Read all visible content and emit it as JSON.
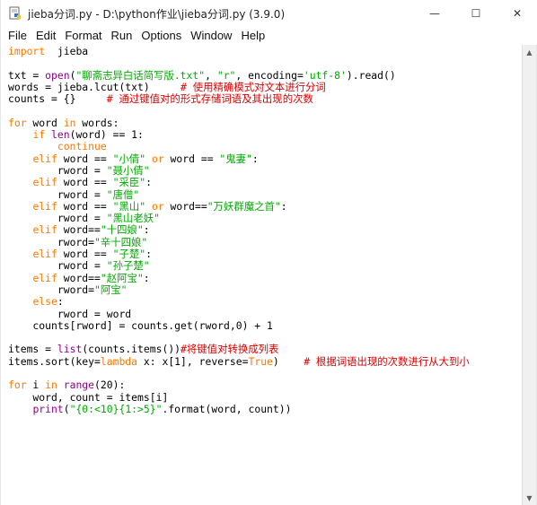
{
  "window": {
    "title": "jieba分词.py - D:\\python作业\\jieba分词.py (3.9.0)",
    "controls": {
      "minimize": "—",
      "maximize": "☐",
      "close": "✕"
    }
  },
  "menu": [
    "File",
    "Edit",
    "Format",
    "Run",
    "Options",
    "Window",
    "Help"
  ],
  "icons": {
    "app": "python-idle-file-icon"
  },
  "colors": {
    "keyword": "#ff7700",
    "builtin": "#900090",
    "string": "#00aa00",
    "comment": "#dd0000",
    "text": "#000000"
  },
  "code_lines": [
    [
      {
        "t": "kw",
        "s": "import"
      },
      {
        "t": "n",
        "s": "  jieba"
      }
    ],
    [],
    [
      {
        "t": "n",
        "s": "txt = "
      },
      {
        "t": "bi",
        "s": "open"
      },
      {
        "t": "n",
        "s": "("
      },
      {
        "t": "str",
        "s": "\"聊斋志异白话简写版.txt\""
      },
      {
        "t": "n",
        "s": ", "
      },
      {
        "t": "str",
        "s": "\"r\""
      },
      {
        "t": "n",
        "s": ", encoding="
      },
      {
        "t": "str",
        "s": "'utf-8'"
      },
      {
        "t": "n",
        "s": ").read()"
      }
    ],
    [
      {
        "t": "n",
        "s": "words = jieba.lcut(txt)     "
      },
      {
        "t": "cmt",
        "s": "# 使用精确模式对文本进行分词"
      }
    ],
    [
      {
        "t": "n",
        "s": "counts = {}     "
      },
      {
        "t": "cmt",
        "s": "# 通过键值对的形式存储词语及其出现的次数"
      }
    ],
    [],
    [
      {
        "t": "kw",
        "s": "for"
      },
      {
        "t": "n",
        "s": " word "
      },
      {
        "t": "kw",
        "s": "in"
      },
      {
        "t": "n",
        "s": " words:"
      }
    ],
    [
      {
        "t": "n",
        "s": "    "
      },
      {
        "t": "kw",
        "s": "if"
      },
      {
        "t": "n",
        "s": " "
      },
      {
        "t": "bi",
        "s": "len"
      },
      {
        "t": "n",
        "s": "(word) == 1:"
      }
    ],
    [
      {
        "t": "n",
        "s": "        "
      },
      {
        "t": "kw",
        "s": "continue"
      }
    ],
    [
      {
        "t": "n",
        "s": "    "
      },
      {
        "t": "kw",
        "s": "elif"
      },
      {
        "t": "n",
        "s": " word == "
      },
      {
        "t": "str",
        "s": "\"小倩\""
      },
      {
        "t": "n",
        "s": " "
      },
      {
        "t": "kw",
        "s": "or"
      },
      {
        "t": "n",
        "s": " word == "
      },
      {
        "t": "str",
        "s": "\"鬼妻\""
      },
      {
        "t": "n",
        "s": ":"
      }
    ],
    [
      {
        "t": "n",
        "s": "        rword = "
      },
      {
        "t": "str",
        "s": "\"聂小倩\""
      }
    ],
    [
      {
        "t": "n",
        "s": "    "
      },
      {
        "t": "kw",
        "s": "elif"
      },
      {
        "t": "n",
        "s": " word == "
      },
      {
        "t": "str",
        "s": "\"采臣\""
      },
      {
        "t": "n",
        "s": ":"
      }
    ],
    [
      {
        "t": "n",
        "s": "        rword = "
      },
      {
        "t": "str",
        "s": "\"唐僧\""
      }
    ],
    [
      {
        "t": "n",
        "s": "    "
      },
      {
        "t": "kw",
        "s": "elif"
      },
      {
        "t": "n",
        "s": " word == "
      },
      {
        "t": "str",
        "s": "\"黑山\""
      },
      {
        "t": "n",
        "s": " "
      },
      {
        "t": "kw",
        "s": "or"
      },
      {
        "t": "n",
        "s": " word=="
      },
      {
        "t": "str",
        "s": "\"万妖群魔之首\""
      },
      {
        "t": "n",
        "s": ":"
      }
    ],
    [
      {
        "t": "n",
        "s": "        rword = "
      },
      {
        "t": "str",
        "s": "\"黑山老妖\""
      }
    ],
    [
      {
        "t": "n",
        "s": "    "
      },
      {
        "t": "kw",
        "s": "elif"
      },
      {
        "t": "n",
        "s": " word=="
      },
      {
        "t": "str",
        "s": "\"十四娘\""
      },
      {
        "t": "n",
        "s": ":"
      }
    ],
    [
      {
        "t": "n",
        "s": "        rword="
      },
      {
        "t": "str",
        "s": "\"辛十四娘\""
      }
    ],
    [
      {
        "t": "n",
        "s": "    "
      },
      {
        "t": "kw",
        "s": "elif"
      },
      {
        "t": "n",
        "s": " word == "
      },
      {
        "t": "str",
        "s": "\"子楚\""
      },
      {
        "t": "n",
        "s": ":"
      }
    ],
    [
      {
        "t": "n",
        "s": "        rword = "
      },
      {
        "t": "str",
        "s": "\"孙子楚\""
      }
    ],
    [
      {
        "t": "n",
        "s": "    "
      },
      {
        "t": "kw",
        "s": "elif"
      },
      {
        "t": "n",
        "s": " word=="
      },
      {
        "t": "str",
        "s": "\"赵阿宝\""
      },
      {
        "t": "n",
        "s": ":"
      }
    ],
    [
      {
        "t": "n",
        "s": "        rword="
      },
      {
        "t": "str",
        "s": "\"阿宝\""
      }
    ],
    [
      {
        "t": "n",
        "s": "    "
      },
      {
        "t": "kw",
        "s": "else"
      },
      {
        "t": "n",
        "s": ":"
      }
    ],
    [
      {
        "t": "n",
        "s": "        rword = word"
      }
    ],
    [
      {
        "t": "n",
        "s": "    counts[rword] = counts.get(rword,0) + 1"
      }
    ],
    [],
    [
      {
        "t": "n",
        "s": "items = "
      },
      {
        "t": "bi",
        "s": "list"
      },
      {
        "t": "n",
        "s": "(counts.items())"
      },
      {
        "t": "cmt",
        "s": "#将键值对转换成列表"
      }
    ],
    [
      {
        "t": "n",
        "s": "items.sort(key="
      },
      {
        "t": "kw",
        "s": "lambda"
      },
      {
        "t": "n",
        "s": " x: x[1], reverse="
      },
      {
        "t": "kw",
        "s": "True"
      },
      {
        "t": "n",
        "s": ")    "
      },
      {
        "t": "cmt",
        "s": "# 根据词语出现的次数进行从大到小"
      }
    ],
    [],
    [
      {
        "t": "kw",
        "s": "for"
      },
      {
        "t": "n",
        "s": " i "
      },
      {
        "t": "kw",
        "s": "in"
      },
      {
        "t": "n",
        "s": " "
      },
      {
        "t": "bi",
        "s": "range"
      },
      {
        "t": "n",
        "s": "(20):"
      }
    ],
    [
      {
        "t": "n",
        "s": "    word, count = items[i]"
      }
    ],
    [
      {
        "t": "n",
        "s": "    "
      },
      {
        "t": "bi",
        "s": "print"
      },
      {
        "t": "n",
        "s": "("
      },
      {
        "t": "str",
        "s": "\"{0:<10}{1:>5}\""
      },
      {
        "t": "n",
        "s": ".format(word, count))"
      }
    ]
  ]
}
